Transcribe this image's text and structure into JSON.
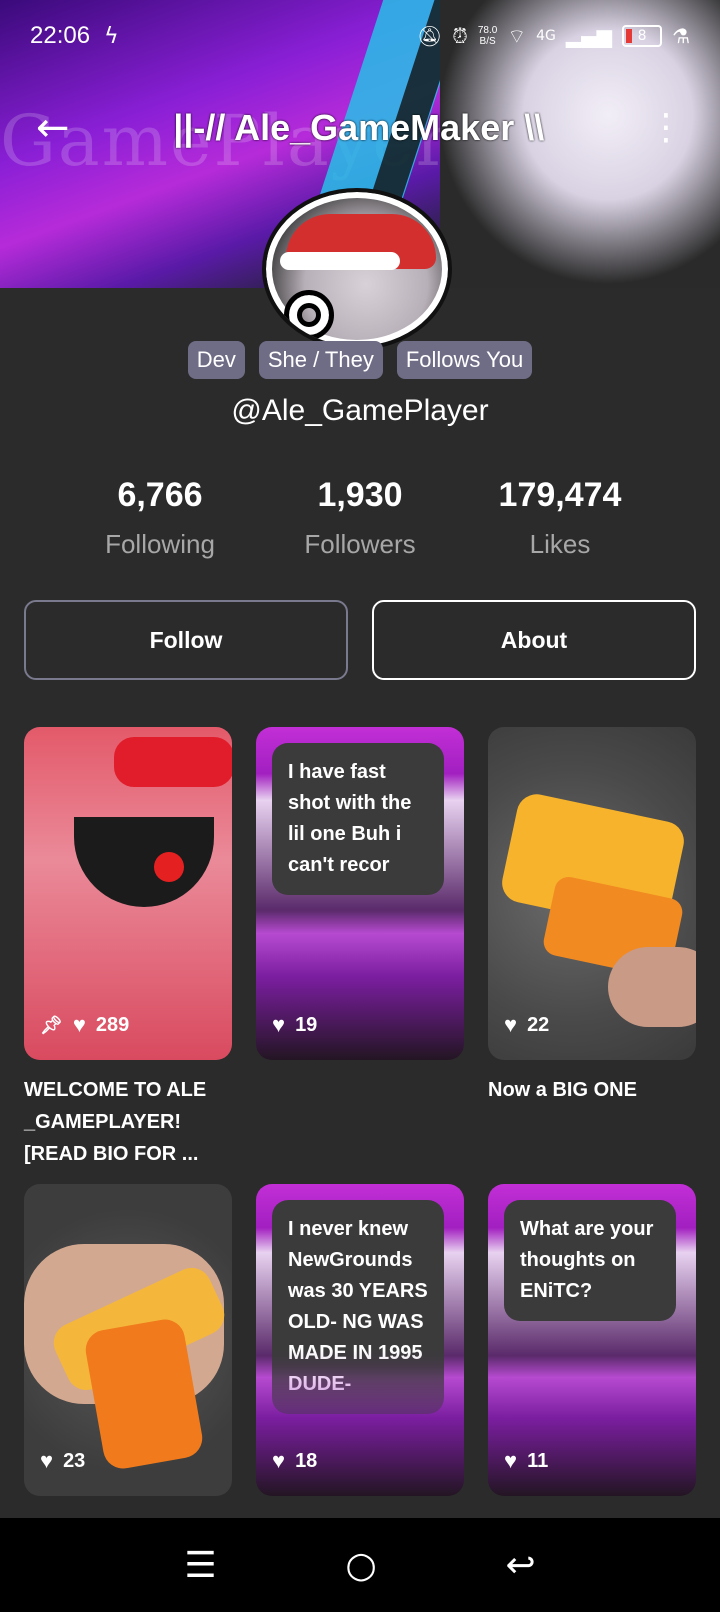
{
  "status_bar": {
    "time": "22:06",
    "net_speed_value": "78.0",
    "net_speed_unit": "B/S",
    "network": "4G",
    "battery": "8"
  },
  "header": {
    "title": "||-// Ale_GameMaker \\\\",
    "banner_watermark": "GamePlayer"
  },
  "profile": {
    "badges": [
      "Dev",
      "She / They",
      "Follows You"
    ],
    "handle": "@Ale_GamePlayer",
    "stats": [
      {
        "value": "6,766",
        "label": "Following"
      },
      {
        "value": "1,930",
        "label": "Followers"
      },
      {
        "value": "179,474",
        "label": "Likes"
      }
    ]
  },
  "actions": {
    "follow_label": "Follow",
    "about_label": "About"
  },
  "posts": [
    {
      "likes": "289",
      "pinned": true,
      "caption": "WELCOME TO ALE _GAMEPLAYER! [READ BIO FOR ...",
      "text": ""
    },
    {
      "likes": "19",
      "pinned": false,
      "caption": "",
      "text": "I have fast shot with the lil one Buh i can't recor"
    },
    {
      "likes": "22",
      "pinned": false,
      "caption": "Now a BIG ONE",
      "text": ""
    },
    {
      "likes": "23",
      "pinned": false,
      "caption": "",
      "text": ""
    },
    {
      "likes": "18",
      "pinned": false,
      "caption": "",
      "text": "I never knew NewGrounds was 30 YEARS OLD- NG WAS MADE IN 1995 DUDE-"
    },
    {
      "likes": "11",
      "pinned": false,
      "caption": "",
      "text": "What are your thoughts on ENiTC?"
    }
  ],
  "colors": {
    "background": "#2b2b2b",
    "badge": "#6f6c86",
    "muted_text": "#a7a7a7"
  }
}
